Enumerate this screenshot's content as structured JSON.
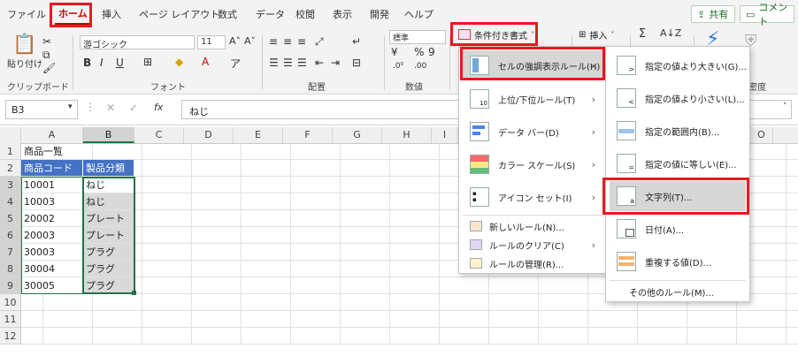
{
  "tabs": [
    "ファイル",
    "ホーム",
    "挿入",
    "ページ レイアウト",
    "数式",
    "データ",
    "校閲",
    "表示",
    "開発",
    "ヘルプ"
  ],
  "active_tab": "ホーム",
  "share_label": "共有",
  "comment_label": "コメント",
  "ribbon": {
    "paste_label": "貼り付け",
    "font_name": "游ゴシック",
    "font_size": "11",
    "number_format": "標準",
    "cond_format_label": "条件付き書式",
    "insert_label": "挿入",
    "groups": {
      "clipboard": "クリップボード",
      "font": "フォント",
      "alignment": "配置",
      "number": "数値",
      "density": "密度"
    }
  },
  "formula_bar": {
    "name_box": "B3",
    "fx": "fx",
    "content": "ねじ"
  },
  "columns": [
    "A",
    "B",
    "C",
    "D",
    "E",
    "F",
    "G",
    "H",
    "I",
    "O"
  ],
  "rows": [
    "1",
    "2",
    "3",
    "4",
    "5",
    "6",
    "7",
    "8",
    "9",
    "10",
    "11",
    "12"
  ],
  "cells": {
    "a1": "商品一覧",
    "header_code": "商品コード",
    "header_category": "製品分類",
    "data": [
      {
        "code": "10001",
        "category": "ねじ"
      },
      {
        "code": "10003",
        "category": "ねじ"
      },
      {
        "code": "20002",
        "category": "プレート"
      },
      {
        "code": "20003",
        "category": "プレート"
      },
      {
        "code": "30003",
        "category": "プラグ"
      },
      {
        "code": "30004",
        "category": "プラグ"
      },
      {
        "code": "30005",
        "category": "プラグ"
      }
    ]
  },
  "main_menu": {
    "items": [
      {
        "label": "セルの強調表示ルール(H)",
        "has_submenu": true
      },
      {
        "label": "上位/下位ルール(T)",
        "has_submenu": true
      },
      {
        "label": "データ バー(D)",
        "has_submenu": true
      },
      {
        "label": "カラー スケール(S)",
        "has_submenu": true
      },
      {
        "label": "アイコン セット(I)",
        "has_submenu": true
      }
    ],
    "small_items": [
      {
        "label": "新しいルール(N)..."
      },
      {
        "label": "ルールのクリア(C)",
        "has_submenu": true
      },
      {
        "label": "ルールの管理(R)..."
      }
    ]
  },
  "sub_menu": {
    "items": [
      {
        "label": "指定の値より大きい(G)..."
      },
      {
        "label": "指定の値より小さい(L)..."
      },
      {
        "label": "指定の範囲内(B)..."
      },
      {
        "label": "指定の値に等しい(E)..."
      },
      {
        "label": "文字列(T)..."
      },
      {
        "label": "日付(A)..."
      },
      {
        "label": "重複する値(D)..."
      }
    ],
    "other": "その他のルール(M)..."
  },
  "colors": {
    "highlight_red": "#e8191f",
    "table_header": "#4472c4",
    "excel_green": "#217346"
  }
}
